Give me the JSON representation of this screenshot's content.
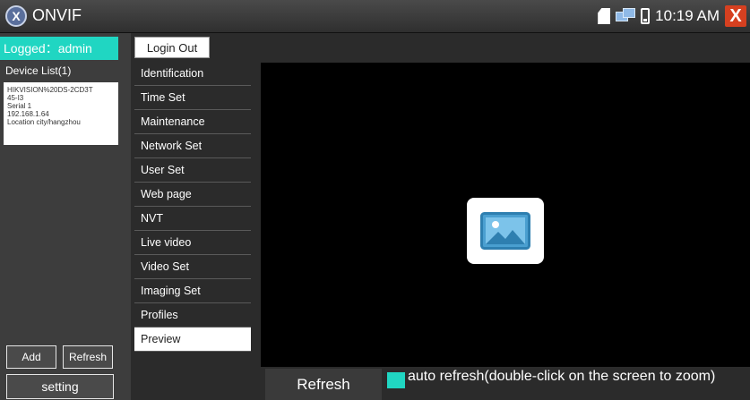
{
  "titlebar": {
    "app_name": "ONVIF",
    "logo_glyph": "X",
    "clock": "10:19 AM",
    "close_glyph": "X"
  },
  "sidebar": {
    "logged_label": "Logged：admin",
    "device_list_title": "Device List(1)",
    "device": {
      "name_line1": "HIKVISION%20DS-2CD3T",
      "name_line2": "45-I3",
      "serial": "Serial 1",
      "ip": "192.168.1.64",
      "location": "Location city/hangzhou"
    },
    "add_label": "Add",
    "refresh_label": "Refresh",
    "setting_label": "setting"
  },
  "login_out_label": "Login Out",
  "menu": {
    "items": [
      "Identification",
      "Time Set",
      "Maintenance",
      "Network Set",
      "User Set",
      "Web page",
      "NVT",
      "Live video",
      "Video Set",
      "Imaging Set",
      "Profiles",
      "Preview"
    ],
    "selected": "Preview"
  },
  "viewer": {
    "placeholder_icon": "image-icon"
  },
  "bottom": {
    "refresh_label": "Refresh",
    "auto_refresh_label": "auto refresh(double-click on the screen to zoom)"
  },
  "colors": {
    "accent": "#20d6c2",
    "close": "#d64020"
  }
}
